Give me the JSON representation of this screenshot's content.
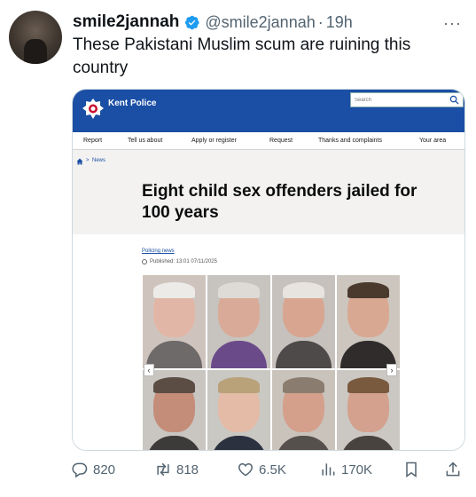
{
  "tweet": {
    "display_name": "smile2jannah",
    "handle": "@smile2jannah",
    "separator": "·",
    "timestamp": "19h",
    "more": "···",
    "text": "These Pakistani Muslim scum are ruining this country"
  },
  "card": {
    "logo_text": "Kent Police",
    "search_placeholder": "Search",
    "nav": [
      "Report",
      "Tell us about",
      "Apply or register",
      "Request",
      "Thanks and complaints",
      "Your area"
    ],
    "breadcrumb": {
      "sep": ">",
      "label": "News"
    },
    "title": "Eight child sex offenders jailed for 100 years",
    "category": "Policing news",
    "published": "Published: 13:01 07/11/2025",
    "carousel": {
      "prev": "‹",
      "next": "›"
    }
  },
  "actions": {
    "replies": "820",
    "reposts": "818",
    "likes": "6.5K",
    "views": "170K"
  },
  "colors": {
    "kent_blue": "#1a4fa5",
    "verified": "#1d9bf0",
    "muted": "#536471"
  }
}
